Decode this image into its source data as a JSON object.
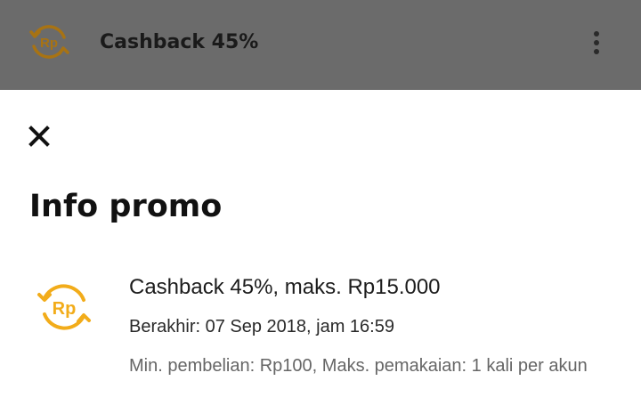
{
  "header": {
    "title": "Cashback 45%",
    "icon": "rupiah-cashback-icon",
    "menu_icon": "more-vertical-icon",
    "icon_color": "#a87313",
    "background": "#6b6b6b"
  },
  "sheet": {
    "close_icon": "close-icon",
    "title": "Info promo"
  },
  "promo": {
    "icon": "rupiah-cashback-icon",
    "icon_color": "#f2ac1a",
    "icon_text": "Rp",
    "title": "Cashback 45%, maks. Rp15.000",
    "expiry": "Berakhir: 07 Sep 2018, jam 16:59",
    "terms": "Min. pembelian: Rp100, Maks. pemakaian: 1 kali per akun"
  }
}
